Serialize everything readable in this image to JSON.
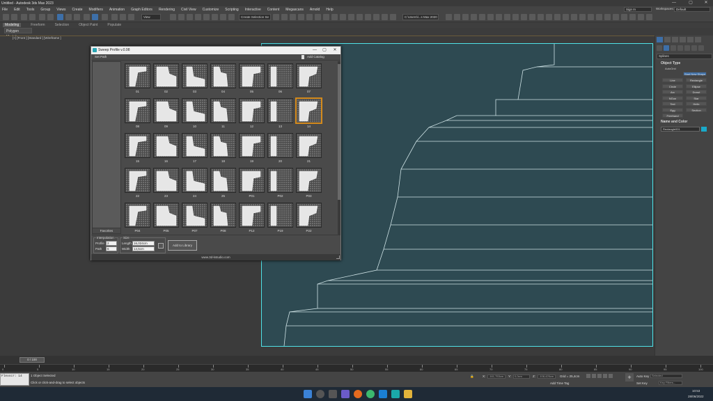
{
  "window": {
    "title": "Untitled - Autodesk 3ds Max 2023",
    "minimize": "—",
    "maximize": "▢",
    "close": "✕"
  },
  "menu": [
    "File",
    "Edit",
    "Tools",
    "Group",
    "Views",
    "Create",
    "Modifiers",
    "Animation",
    "Graph Editors",
    "Rendering",
    "Civil View",
    "Customize",
    "Scripting",
    "Interactive",
    "Content",
    "Megascans",
    "Arnold",
    "Help"
  ],
  "account": {
    "sign_in": "Sign In",
    "workspaces_label": "Workspaces:",
    "workspace": "Default"
  },
  "toolbar": {
    "view_select": "View",
    "selection_set": "Create Selection Se",
    "path": "C:\\Users\\l...s Max 2020"
  },
  "ribbon": {
    "tabs": [
      "Modeling",
      "Freeform",
      "Selection",
      "Object Paint",
      "Populate"
    ],
    "sub": "Polygon Modeling"
  },
  "viewport": {
    "label": "[+] [Front ] [Standard ] [Wireframe ]"
  },
  "command_panel": {
    "category": "Splines",
    "object_type_header": "Object Type",
    "autogrid": "AutoGrid",
    "start_new_shape": "Start New Shape",
    "buttons": [
      "Line",
      "Rectangle",
      "Circle",
      "Ellipse",
      "Arc",
      "Donut",
      "NGon",
      "Star",
      "Text",
      "Helix",
      "Egg",
      "Section",
      "Freehand"
    ],
    "name_color_header": "Name and Color",
    "object_name": "Rectangle001",
    "object_color": "#1aa9c9"
  },
  "dialog": {
    "title": "Sweep Profile v.0.98",
    "set_path": "Set Path",
    "add_catalog": "Add Catalog",
    "favorites": "Favorites",
    "thumbnails": [
      {
        "label": "01"
      },
      {
        "label": "02"
      },
      {
        "label": "03"
      },
      {
        "label": "04"
      },
      {
        "label": "05"
      },
      {
        "label": "06"
      },
      {
        "label": "07"
      },
      {
        "label": "08"
      },
      {
        "label": "09"
      },
      {
        "label": "10"
      },
      {
        "label": "11"
      },
      {
        "label": "12"
      },
      {
        "label": "13"
      },
      {
        "label": "14",
        "selected": true
      },
      {
        "label": "15"
      },
      {
        "label": "16"
      },
      {
        "label": "17"
      },
      {
        "label": "18"
      },
      {
        "label": "19"
      },
      {
        "label": "20"
      },
      {
        "label": "21"
      },
      {
        "label": "22"
      },
      {
        "label": "23"
      },
      {
        "label": "24"
      },
      {
        "label": "25"
      },
      {
        "label": "P01"
      },
      {
        "label": "P02"
      },
      {
        "label": "P03"
      },
      {
        "label": "P04"
      },
      {
        "label": "P05"
      },
      {
        "label": "P07"
      },
      {
        "label": "P08"
      },
      {
        "label": "P12"
      },
      {
        "label": "P19"
      },
      {
        "label": "P22"
      }
    ],
    "interpolation": {
      "title": "Interpolation",
      "profile_label": "Profile",
      "profile_value": "2",
      "path_label": "Path",
      "path_value": "6"
    },
    "size": {
      "title": "Size",
      "length_label": "Length",
      "length_value": "16,024cm",
      "width_label": "Width",
      "width_value": "14,5cm"
    },
    "add_to_library": "Add to Library",
    "footer": "www.3d-kstudio.com"
  },
  "timeslider": {
    "position": "0 / 100"
  },
  "timeline_ticks": [
    "0",
    "5",
    "10",
    "15",
    "20",
    "25",
    "30",
    "35",
    "40",
    "45",
    "50",
    "55",
    "60",
    "65",
    "70",
    "75",
    "80",
    "85",
    "90",
    "95",
    "100"
  ],
  "status": {
    "maxscript": "Flexscr: 14",
    "selected": "1 Object Selected",
    "hint": "Click or click-and-drag to select objects",
    "x_label": "X:",
    "x_value": "-161,753cm",
    "y_label": "Y:",
    "y_value": "0,0cm",
    "z_label": "Z:",
    "z_value": "-108,425cm",
    "grid": "Grid = 25,4cm",
    "add_time_tag": "Add Time Tag",
    "auto_key": "Auto Key",
    "selected_dropdown": "Selected",
    "set_key": "Set Key",
    "key_filters": "Key Filters..."
  },
  "tray": {
    "time": "10:53",
    "date": "28/06/2022"
  }
}
